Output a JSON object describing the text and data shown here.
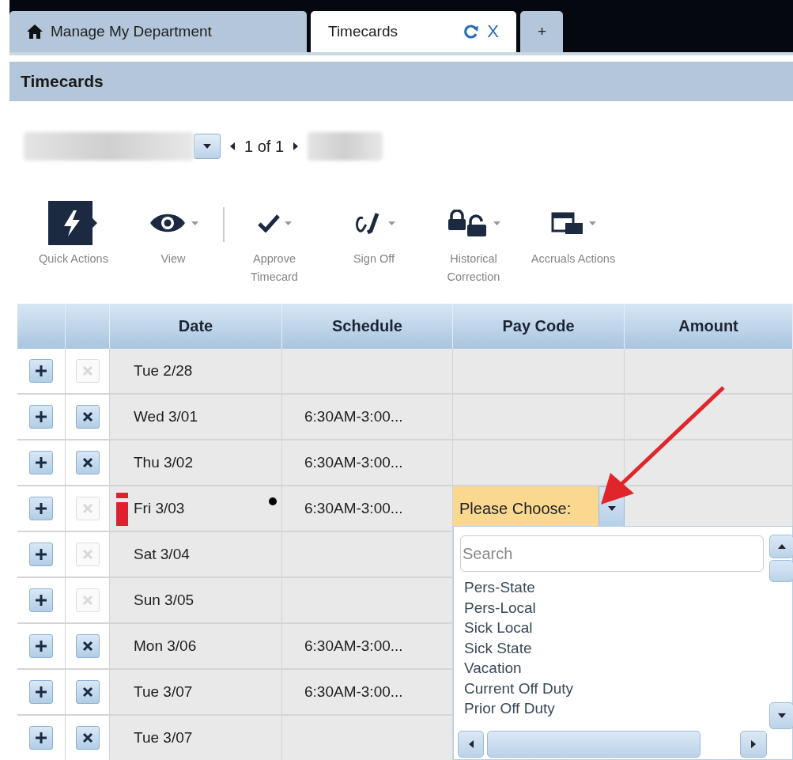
{
  "tabs": [
    {
      "kind": "home",
      "label": "Manage My Department",
      "selected": false
    },
    {
      "kind": "page",
      "label": "Timecards",
      "selected": true,
      "close": "X"
    },
    {
      "kind": "add",
      "label": "+",
      "selected": false
    }
  ],
  "header": {
    "title": "Timecards"
  },
  "navigator": {
    "page": "1 of 1"
  },
  "toolbar": [
    {
      "kind": "lightning",
      "label": "Quick Actions",
      "caret": false,
      "separator_after": false
    },
    {
      "kind": "eye",
      "label": "View",
      "caret": true,
      "separator_after": true
    },
    {
      "kind": "check",
      "label": "Approve Timecard",
      "caret": true,
      "separator_after": false
    },
    {
      "kind": "sign",
      "label": "Sign Off",
      "caret": true,
      "separator_after": false
    },
    {
      "kind": "locks",
      "label": "Historical Correction",
      "caret": true,
      "separator_after": false
    },
    {
      "kind": "calendar",
      "label": "Accruals Actions",
      "caret": true,
      "separator_after": false
    }
  ],
  "table": {
    "columns": [
      "Date",
      "Schedule",
      "Pay Code",
      "Amount"
    ],
    "rows": [
      {
        "date": "Tue 2/28",
        "schedule": "",
        "can_delete": false,
        "flagged": false,
        "dot": false
      },
      {
        "date": "Wed 3/01",
        "schedule": "6:30AM-3:00...",
        "can_delete": true,
        "flagged": false,
        "dot": false
      },
      {
        "date": "Thu 3/02",
        "schedule": "6:30AM-3:00...",
        "can_delete": true,
        "flagged": false,
        "dot": false
      },
      {
        "date": "Fri 3/03",
        "schedule": "6:30AM-3:00...",
        "can_delete": false,
        "flagged": true,
        "dot": true,
        "pay_code": "Please Choose:"
      },
      {
        "date": "Sat 3/04",
        "schedule": "",
        "can_delete": false,
        "flagged": false,
        "dot": false
      },
      {
        "date": "Sun 3/05",
        "schedule": "",
        "can_delete": false,
        "flagged": false,
        "dot": false
      },
      {
        "date": "Mon 3/06",
        "schedule": "6:30AM-3:00...",
        "can_delete": true,
        "flagged": false,
        "dot": false
      },
      {
        "date": "Tue 3/07",
        "schedule": "6:30AM-3:00...",
        "can_delete": true,
        "flagged": false,
        "dot": false
      },
      {
        "date": "Tue 3/07",
        "schedule": "",
        "can_delete": true,
        "flagged": false,
        "dot": false
      }
    ]
  },
  "pay_code_dropdown": {
    "search": {
      "placeholder": "Search"
    },
    "options": [
      "Pers-State",
      "Pers-Local",
      "Sick Local",
      "Sick State",
      "Vacation",
      "Current Off Duty",
      "Prior Off Duty"
    ]
  }
}
